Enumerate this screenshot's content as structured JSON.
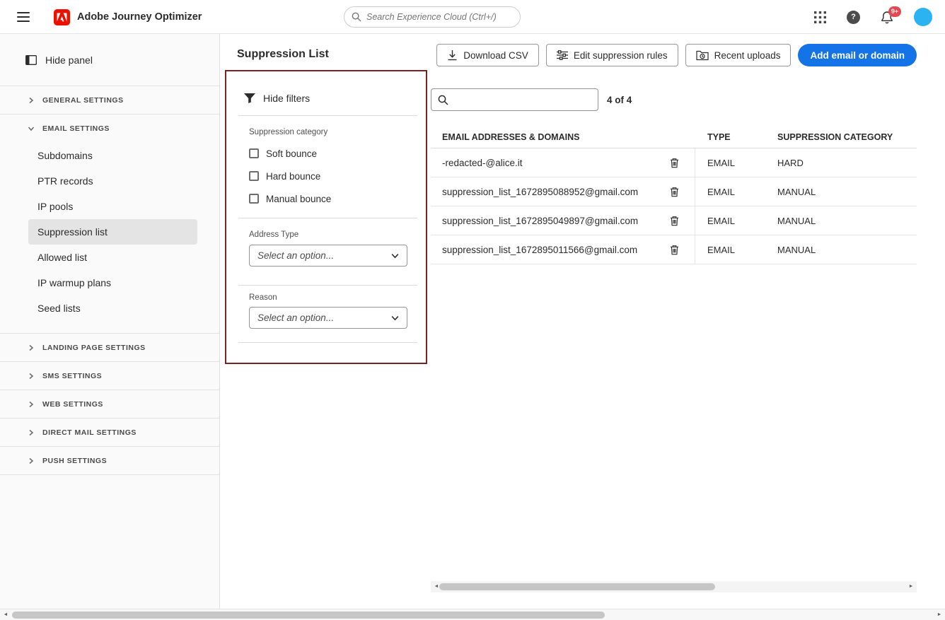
{
  "topbar": {
    "app_title": "Adobe Journey Optimizer",
    "search_placeholder": "Search Experience Cloud (Ctrl+/)",
    "notification_badge": "9+"
  },
  "sidebar": {
    "hide_panel_label": "Hide panel",
    "sections": [
      {
        "label": "GENERAL SETTINGS",
        "expanded": false
      },
      {
        "label": "EMAIL SETTINGS",
        "expanded": true,
        "items": [
          {
            "label": "Subdomains"
          },
          {
            "label": "PTR records"
          },
          {
            "label": "IP pools"
          },
          {
            "label": "Suppression list",
            "selected": true
          },
          {
            "label": "Allowed list"
          },
          {
            "label": "IP warmup plans"
          },
          {
            "label": "Seed lists"
          }
        ]
      },
      {
        "label": "LANDING PAGE SETTINGS",
        "expanded": false
      },
      {
        "label": "SMS SETTINGS",
        "expanded": false
      },
      {
        "label": "WEB SETTINGS",
        "expanded": false
      },
      {
        "label": "DIRECT MAIL SETTINGS",
        "expanded": false
      },
      {
        "label": "PUSH SETTINGS",
        "expanded": false
      }
    ]
  },
  "main": {
    "title": "Suppression List",
    "actions": {
      "download_csv": "Download CSV",
      "edit_suppression_rules": "Edit suppression rules",
      "recent_uploads": "Recent uploads",
      "add_email_or_domain": "Add email or domain"
    },
    "filters": {
      "hide_filters_label": "Hide filters",
      "suppression_category_label": "Suppression category",
      "checkboxes": [
        "Soft bounce",
        "Hard bounce",
        "Manual bounce"
      ],
      "address_type_label": "Address Type",
      "address_type_value": "Select an option...",
      "reason_label": "Reason",
      "reason_value": "Select an option..."
    },
    "table": {
      "search_value": "",
      "result_count": "4 of 4",
      "headers": [
        "EMAIL ADDRESSES & DOMAINS",
        "TYPE",
        "SUPPRESSION CATEGORY"
      ],
      "rows": [
        {
          "email": "-redacted-@alice.it",
          "type": "EMAIL",
          "category": "HARD"
        },
        {
          "email": "suppression_list_1672895088952@gmail.com",
          "type": "EMAIL",
          "category": "MANUAL"
        },
        {
          "email": "suppression_list_1672895049897@gmail.com",
          "type": "EMAIL",
          "category": "MANUAL"
        },
        {
          "email": "suppression_list_1672895011566@gmail.com",
          "type": "EMAIL",
          "category": "MANUAL"
        }
      ]
    }
  },
  "colors": {
    "accent_blue": "#1473e6",
    "annotation_red": "#7a2323",
    "badge_red": "#e34850",
    "avatar_blue": "#2bb2f0"
  }
}
